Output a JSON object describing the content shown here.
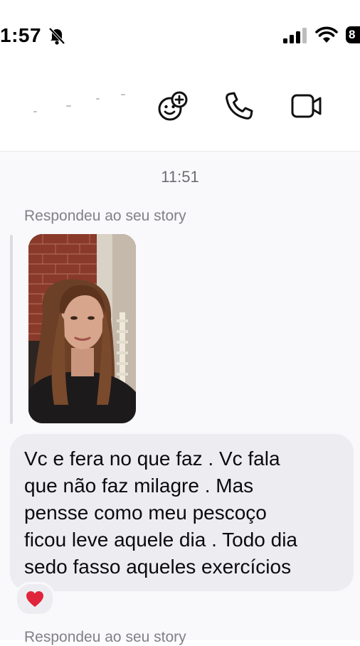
{
  "status_bar": {
    "time": "1:57",
    "battery": "8",
    "icons": [
      "bell-slash-icon",
      "signal-icon",
      "wifi-icon",
      "battery-icon"
    ]
  },
  "header": {
    "buttons": [
      "add-effect-icon",
      "phone-icon",
      "video-camera-icon"
    ]
  },
  "chat": {
    "timestamp": "11:51",
    "story_reply_label": "Respondeu ao seu story",
    "message": {
      "lines": [
        "Vc e fera no que faz .  Vc fala",
        "que não faz milagre . Mas",
        "pensse como meu pescoço",
        "ficou leve aquele dia . Todo dia",
        "sedo fasso aqueles exercícios"
      ],
      "reaction": "❤️"
    },
    "next_story_reply_label": "Respondeu ao seu story"
  },
  "colors": {
    "bubble": "#ededf1",
    "chat_bg": "#f9f8fa",
    "muted_text": "#818187",
    "heart": "#e0243b"
  }
}
